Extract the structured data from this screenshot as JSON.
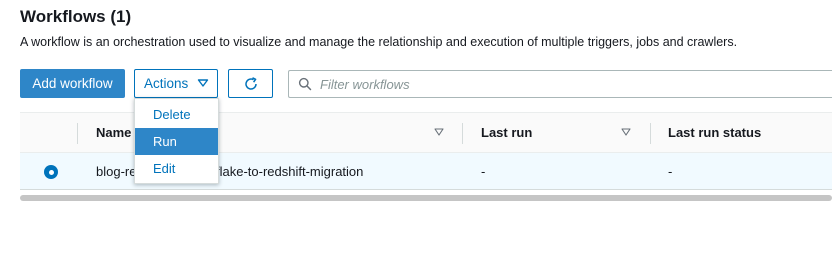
{
  "header": {
    "title": "Workflows (1)",
    "description": "A workflow is an orchestration used to visualize and manage the relationship and execution of multiple triggers, jobs and crawlers."
  },
  "toolbar": {
    "add_label": "Add workflow",
    "actions_label": "Actions",
    "refresh_icon": "refresh-icon",
    "search_placeholder": "Filter workflows",
    "search_value": ""
  },
  "actions_menu": {
    "items": [
      {
        "label": "Delete",
        "highlighted": false
      },
      {
        "label": "Run",
        "highlighted": true
      },
      {
        "label": "Edit",
        "highlighted": false
      }
    ]
  },
  "table": {
    "columns": [
      "Name",
      "Last run",
      "Last run status"
    ],
    "rows": [
      {
        "selected": true,
        "name_prefix": "blog-re",
        "name_suffix": "flake-to-redshift-migration",
        "last_run": "-",
        "last_run_status": "-"
      }
    ]
  },
  "colors": {
    "primary": "#2e86c8",
    "link": "#0073bb",
    "selected_row": "#f1faff"
  }
}
